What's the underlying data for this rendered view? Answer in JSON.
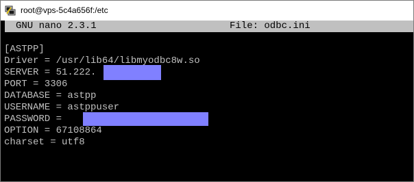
{
  "window": {
    "title": "root@vps-5c4a656f:/etc",
    "icon": "putty-terminal-icon"
  },
  "nano": {
    "version": "GNU nano 2.3.1",
    "file": "File: odbc.ini"
  },
  "lines": [
    "[ASTPP]",
    "Driver = /usr/lib64/libmyodbc8w.so",
    "SERVER = 51.222.",
    "PORT = 3306",
    "DATABASE = astpp",
    "USERNAME = astppuser",
    "PASSWORD = ",
    "OPTION = 67108864",
    "charset = utf8"
  ],
  "colors": {
    "terminal_bg": "#000000",
    "terminal_fg": "#c0c0c0",
    "header_bg": "#c0c0c0",
    "redaction": "#8080ff"
  }
}
